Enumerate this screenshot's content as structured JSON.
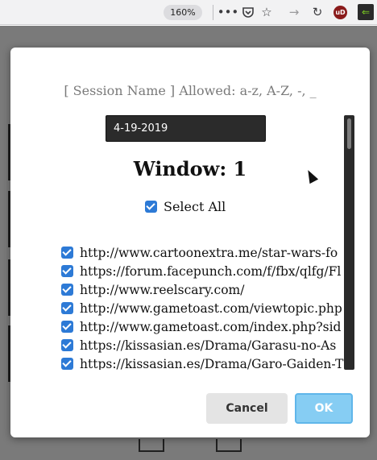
{
  "toolbar": {
    "zoom": "160%",
    "icons": [
      "more-icon",
      "pocket-icon",
      "bookmark-star-icon",
      "forward-icon",
      "reload-icon",
      "ublock-icon",
      "extension-icon"
    ],
    "ublock_label": "uD"
  },
  "modal": {
    "hint": "[ Session Name ] Allowed: a-z, A-Z, -, _",
    "session_name": "4-19-2019",
    "window_title": "Window: 1",
    "select_all": "Select All",
    "urls": [
      "http://www.cartoonextra.me/star-wars-fo",
      "https://forum.facepunch.com/f/fbx/qlfg/Fl",
      "http://www.reelscary.com/",
      "http://www.gametoast.com/viewtopic.php",
      "http://www.gametoast.com/index.php?sid",
      "https://kissasian.es/Drama/Garasu-no-As",
      "https://kissasian.es/Drama/Garo-Gaiden-T"
    ],
    "cancel_label": "Cancel",
    "ok_label": "OK"
  },
  "colors": {
    "accent": "#2d7ad6",
    "ok_button": "#86cdf3",
    "input_bg": "#2b2b2b"
  }
}
